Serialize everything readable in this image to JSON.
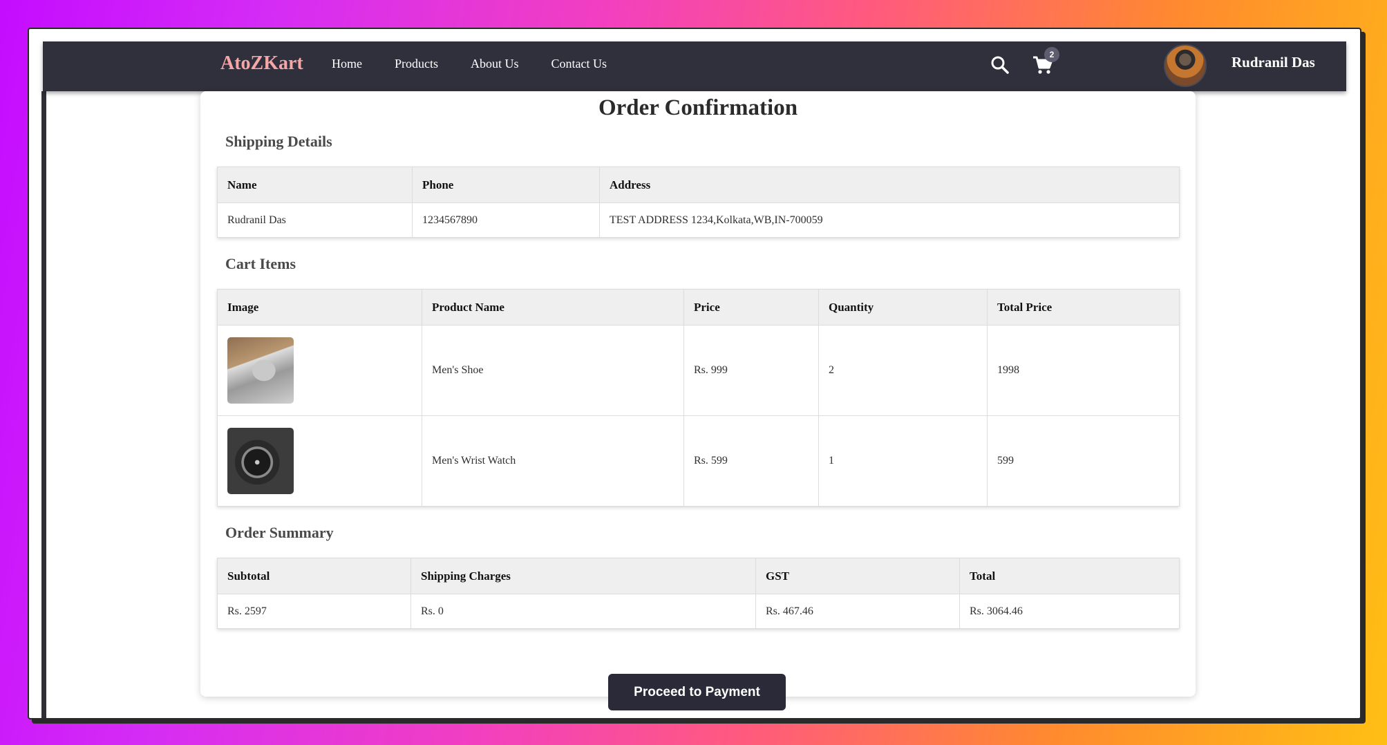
{
  "navbar": {
    "brand": "AtoZKart",
    "links": [
      "Home",
      "Products",
      "About Us",
      "Contact Us"
    ],
    "cart_count": "2",
    "user_name": "Rudranil Das"
  },
  "page": {
    "title": "Order Confirmation"
  },
  "shipping": {
    "title": "Shipping Details",
    "headers": [
      "Name",
      "Phone",
      "Address"
    ],
    "row": [
      "Rudranil Das",
      "1234567890",
      "TEST ADDRESS 1234,Kolkata,WB,IN-700059"
    ]
  },
  "cart": {
    "title": "Cart Items",
    "headers": [
      "Image",
      "Product Name",
      "Price",
      "Quantity",
      "Total Price"
    ],
    "items": [
      {
        "image": "shoe-image",
        "name": "Men's Shoe",
        "price": "Rs. 999",
        "quantity": "2",
        "total": "1998"
      },
      {
        "image": "watch-image",
        "name": "Men's Wrist Watch",
        "price": "Rs. 599",
        "quantity": "1",
        "total": "599"
      }
    ]
  },
  "summary": {
    "title": "Order Summary",
    "headers": [
      "Subtotal",
      "Shipping Charges",
      "GST",
      "Total"
    ],
    "row": [
      "Rs. 2597",
      "Rs. 0",
      "Rs. 467.46",
      "Rs. 3064.46"
    ]
  },
  "actions": {
    "pay_label": "Proceed to Payment"
  },
  "colors": {
    "navbar_bg": "#30303d",
    "brand": "#f5a6a6",
    "button_bg": "#2b2a38"
  }
}
